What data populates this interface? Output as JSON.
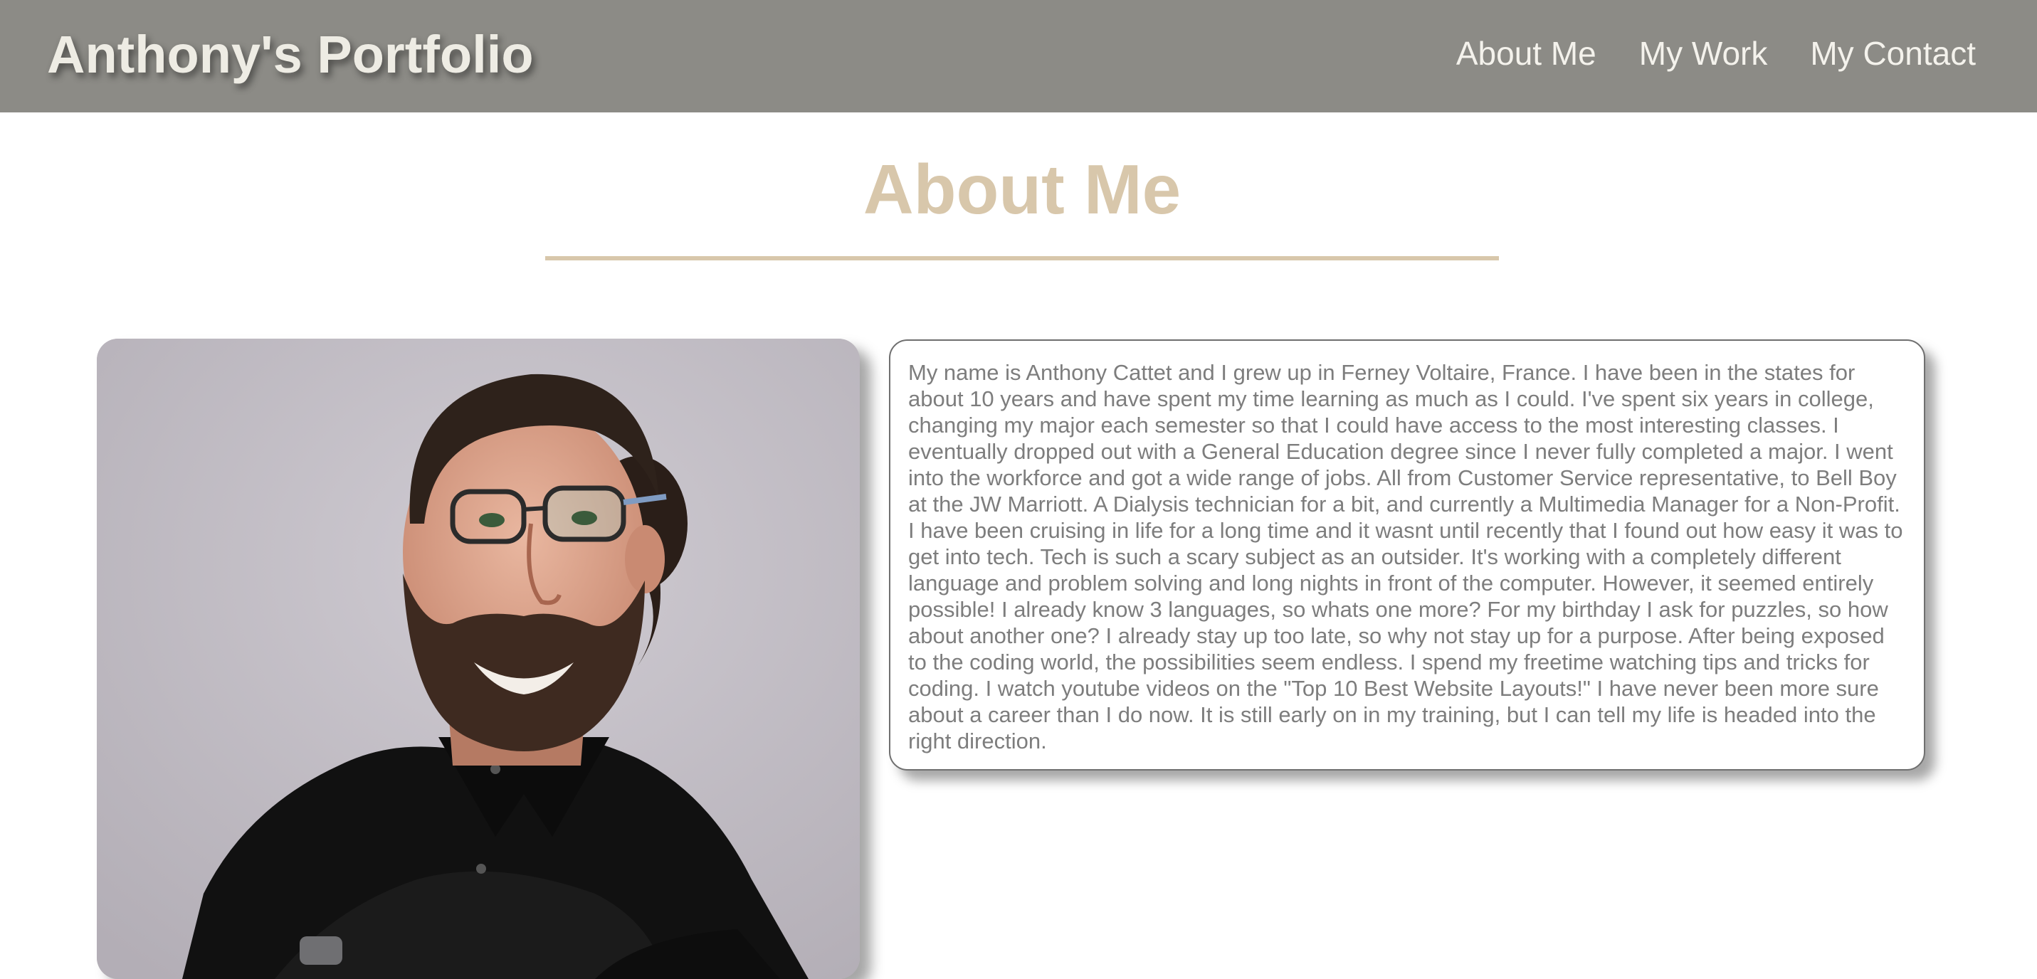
{
  "header": {
    "site_title": "Anthony's Portfolio",
    "nav": [
      {
        "label": "About Me"
      },
      {
        "label": "My Work"
      },
      {
        "label": "My Contact"
      }
    ]
  },
  "about": {
    "heading": "About Me",
    "photo_alt": "Portrait photo of Anthony",
    "bio": "My name is Anthony Cattet and I grew up in Ferney Voltaire, France. I have been in the states for about 10 years and have spent my time learning as much as I could. I've spent six years in college, changing my major each semester so that I could have access to the most interesting classes. I eventually dropped out with a General Education degree since I never fully completed a major. I went into the workforce and got a wide range of jobs. All from Customer Service representative, to Bell Boy at the JW Marriott. A Dialysis technician for a bit, and currently a Multimedia Manager for a Non-Profit. I have been cruising in life for a long time and it wasnt until recently that I found out how easy it was to get into tech. Tech is such a scary subject as an outsider. It's working with a completely different language and problem solving and long nights in front of the computer. However, it seemed entirely possible! I already know 3 languages, so whats one more? For my birthday I ask for puzzles, so how about another one? I already stay up too late, so why not stay up for a purpose. After being exposed to the coding world, the possibilities seem endless. I spend my freetime watching tips and tricks for coding. I watch youtube videos on the \"Top 10 Best Website Layouts!\" I have never been more sure about a career than I do now. It is still early on in my training, but I can tell my life is headed into the right direction."
  },
  "colors": {
    "header_bg": "#8c8b86",
    "accent": "#d8c7ab",
    "title_text": "#eeece4",
    "body_text": "#7d7d7d"
  }
}
